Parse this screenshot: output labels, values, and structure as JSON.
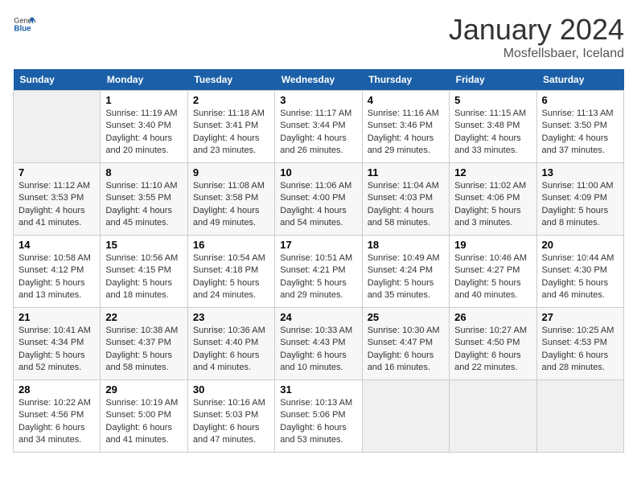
{
  "header": {
    "logo_general": "General",
    "logo_blue": "Blue",
    "month_title": "January 2024",
    "location": "Mosfellsbaer, Iceland"
  },
  "weekdays": [
    "Sunday",
    "Monday",
    "Tuesday",
    "Wednesday",
    "Thursday",
    "Friday",
    "Saturday"
  ],
  "weeks": [
    [
      {
        "day": "",
        "info": ""
      },
      {
        "day": "1",
        "info": "Sunrise: 11:19 AM\nSunset: 3:40 PM\nDaylight: 4 hours\nand 20 minutes."
      },
      {
        "day": "2",
        "info": "Sunrise: 11:18 AM\nSunset: 3:41 PM\nDaylight: 4 hours\nand 23 minutes."
      },
      {
        "day": "3",
        "info": "Sunrise: 11:17 AM\nSunset: 3:44 PM\nDaylight: 4 hours\nand 26 minutes."
      },
      {
        "day": "4",
        "info": "Sunrise: 11:16 AM\nSunset: 3:46 PM\nDaylight: 4 hours\nand 29 minutes."
      },
      {
        "day": "5",
        "info": "Sunrise: 11:15 AM\nSunset: 3:48 PM\nDaylight: 4 hours\nand 33 minutes."
      },
      {
        "day": "6",
        "info": "Sunrise: 11:13 AM\nSunset: 3:50 PM\nDaylight: 4 hours\nand 37 minutes."
      }
    ],
    [
      {
        "day": "7",
        "info": "Sunrise: 11:12 AM\nSunset: 3:53 PM\nDaylight: 4 hours\nand 41 minutes."
      },
      {
        "day": "8",
        "info": "Sunrise: 11:10 AM\nSunset: 3:55 PM\nDaylight: 4 hours\nand 45 minutes."
      },
      {
        "day": "9",
        "info": "Sunrise: 11:08 AM\nSunset: 3:58 PM\nDaylight: 4 hours\nand 49 minutes."
      },
      {
        "day": "10",
        "info": "Sunrise: 11:06 AM\nSunset: 4:00 PM\nDaylight: 4 hours\nand 54 minutes."
      },
      {
        "day": "11",
        "info": "Sunrise: 11:04 AM\nSunset: 4:03 PM\nDaylight: 4 hours\nand 58 minutes."
      },
      {
        "day": "12",
        "info": "Sunrise: 11:02 AM\nSunset: 4:06 PM\nDaylight: 5 hours\nand 3 minutes."
      },
      {
        "day": "13",
        "info": "Sunrise: 11:00 AM\nSunset: 4:09 PM\nDaylight: 5 hours\nand 8 minutes."
      }
    ],
    [
      {
        "day": "14",
        "info": "Sunrise: 10:58 AM\nSunset: 4:12 PM\nDaylight: 5 hours\nand 13 minutes."
      },
      {
        "day": "15",
        "info": "Sunrise: 10:56 AM\nSunset: 4:15 PM\nDaylight: 5 hours\nand 18 minutes."
      },
      {
        "day": "16",
        "info": "Sunrise: 10:54 AM\nSunset: 4:18 PM\nDaylight: 5 hours\nand 24 minutes."
      },
      {
        "day": "17",
        "info": "Sunrise: 10:51 AM\nSunset: 4:21 PM\nDaylight: 5 hours\nand 29 minutes."
      },
      {
        "day": "18",
        "info": "Sunrise: 10:49 AM\nSunset: 4:24 PM\nDaylight: 5 hours\nand 35 minutes."
      },
      {
        "day": "19",
        "info": "Sunrise: 10:46 AM\nSunset: 4:27 PM\nDaylight: 5 hours\nand 40 minutes."
      },
      {
        "day": "20",
        "info": "Sunrise: 10:44 AM\nSunset: 4:30 PM\nDaylight: 5 hours\nand 46 minutes."
      }
    ],
    [
      {
        "day": "21",
        "info": "Sunrise: 10:41 AM\nSunset: 4:34 PM\nDaylight: 5 hours\nand 52 minutes."
      },
      {
        "day": "22",
        "info": "Sunrise: 10:38 AM\nSunset: 4:37 PM\nDaylight: 5 hours\nand 58 minutes."
      },
      {
        "day": "23",
        "info": "Sunrise: 10:36 AM\nSunset: 4:40 PM\nDaylight: 6 hours\nand 4 minutes."
      },
      {
        "day": "24",
        "info": "Sunrise: 10:33 AM\nSunset: 4:43 PM\nDaylight: 6 hours\nand 10 minutes."
      },
      {
        "day": "25",
        "info": "Sunrise: 10:30 AM\nSunset: 4:47 PM\nDaylight: 6 hours\nand 16 minutes."
      },
      {
        "day": "26",
        "info": "Sunrise: 10:27 AM\nSunset: 4:50 PM\nDaylight: 6 hours\nand 22 minutes."
      },
      {
        "day": "27",
        "info": "Sunrise: 10:25 AM\nSunset: 4:53 PM\nDaylight: 6 hours\nand 28 minutes."
      }
    ],
    [
      {
        "day": "28",
        "info": "Sunrise: 10:22 AM\nSunset: 4:56 PM\nDaylight: 6 hours\nand 34 minutes."
      },
      {
        "day": "29",
        "info": "Sunrise: 10:19 AM\nSunset: 5:00 PM\nDaylight: 6 hours\nand 41 minutes."
      },
      {
        "day": "30",
        "info": "Sunrise: 10:16 AM\nSunset: 5:03 PM\nDaylight: 6 hours\nand 47 minutes."
      },
      {
        "day": "31",
        "info": "Sunrise: 10:13 AM\nSunset: 5:06 PM\nDaylight: 6 hours\nand 53 minutes."
      },
      {
        "day": "",
        "info": ""
      },
      {
        "day": "",
        "info": ""
      },
      {
        "day": "",
        "info": ""
      }
    ]
  ]
}
